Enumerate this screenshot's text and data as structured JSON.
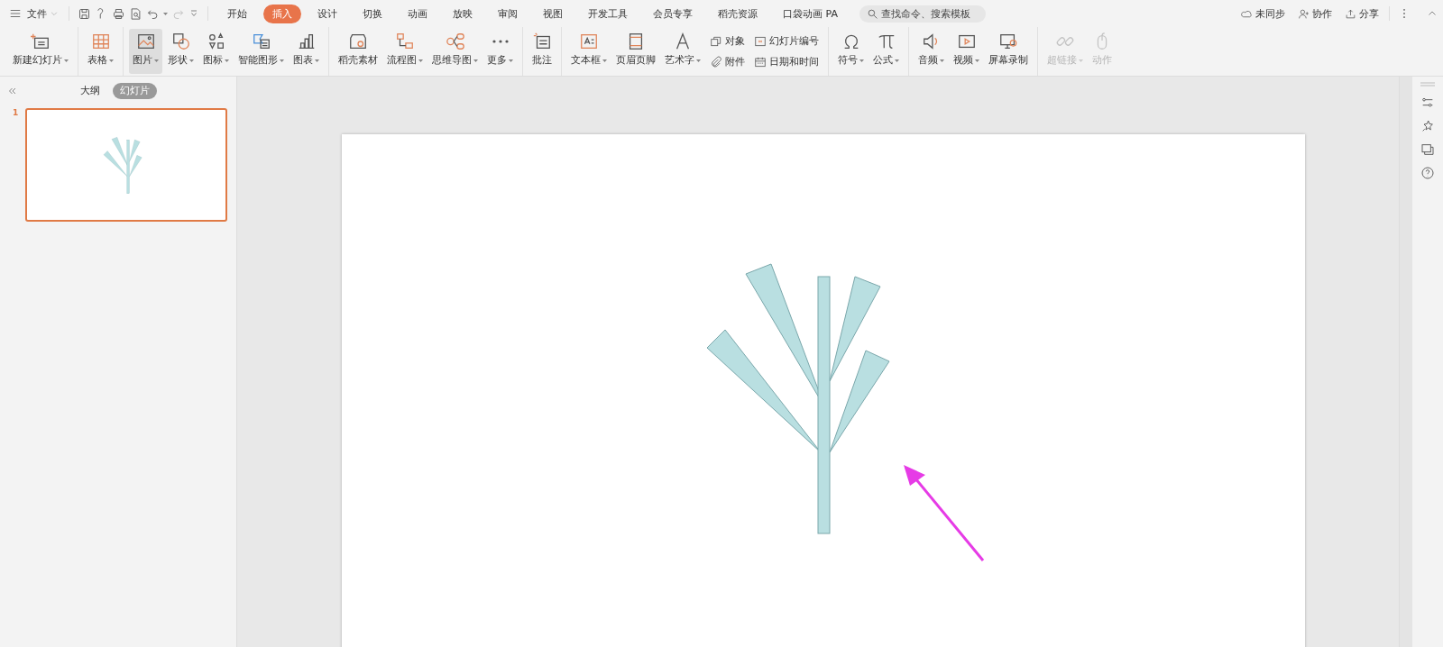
{
  "menu_bar": {
    "file_menu": "文件",
    "tabs": [
      {
        "label": "开始",
        "selected": false
      },
      {
        "label": "插入",
        "selected": true
      },
      {
        "label": "设计",
        "selected": false
      },
      {
        "label": "切换",
        "selected": false
      },
      {
        "label": "动画",
        "selected": false
      },
      {
        "label": "放映",
        "selected": false
      },
      {
        "label": "审阅",
        "selected": false
      },
      {
        "label": "视图",
        "selected": false
      },
      {
        "label": "开发工具",
        "selected": false
      },
      {
        "label": "会员专享",
        "selected": false
      },
      {
        "label": "稻壳资源",
        "selected": false
      },
      {
        "label": "口袋动画 PA",
        "selected": false
      }
    ],
    "search": {
      "placeholder": "查找命令、搜索模板"
    },
    "actions": [
      "未同步",
      "协作",
      "分享"
    ]
  },
  "ribbon": {
    "groups": [
      {
        "items": [
          {
            "kind": "large",
            "label": "新建幻灯片",
            "caret": true,
            "disabled": false,
            "pressed": false
          }
        ]
      },
      {
        "items": [
          {
            "kind": "large",
            "label": "表格",
            "caret": true,
            "disabled": false,
            "pressed": false
          }
        ]
      },
      {
        "items": [
          {
            "kind": "large",
            "label": "图片",
            "caret": true,
            "disabled": false,
            "pressed": true
          },
          {
            "kind": "large",
            "label": "形状",
            "caret": true,
            "disabled": false,
            "pressed": false
          },
          {
            "kind": "large",
            "label": "图标",
            "caret": true,
            "disabled": false,
            "pressed": false
          },
          {
            "kind": "large",
            "label": "智能图形",
            "caret": true,
            "disabled": false,
            "pressed": false
          },
          {
            "kind": "large",
            "label": "图表",
            "caret": true,
            "disabled": false,
            "pressed": false
          }
        ]
      },
      {
        "items": [
          {
            "kind": "large",
            "label": "稻壳素材",
            "caret": false,
            "disabled": false,
            "pressed": false
          },
          {
            "kind": "large",
            "label": "流程图",
            "caret": true,
            "disabled": false,
            "pressed": false
          },
          {
            "kind": "large",
            "label": "思维导图",
            "caret": true,
            "disabled": false,
            "pressed": false
          },
          {
            "kind": "large",
            "label": "更多",
            "caret": true,
            "disabled": false,
            "pressed": false
          }
        ]
      },
      {
        "items": [
          {
            "kind": "large",
            "label": "批注",
            "caret": false,
            "disabled": false,
            "pressed": false
          }
        ]
      },
      {
        "items": [
          {
            "kind": "large",
            "label": "文本框",
            "caret": true,
            "disabled": false,
            "pressed": false
          },
          {
            "kind": "large",
            "label": "页眉页脚",
            "caret": false,
            "disabled": false,
            "pressed": false
          },
          {
            "kind": "large",
            "label": "艺术字",
            "caret": true,
            "disabled": false,
            "pressed": false
          },
          {
            "kind": "small_column",
            "items": [
              {
                "label": "对象"
              },
              {
                "label": "附件"
              }
            ]
          },
          {
            "kind": "small_column",
            "items": [
              {
                "label": "幻灯片编号"
              },
              {
                "label": "日期和时间"
              }
            ]
          }
        ]
      },
      {
        "items": [
          {
            "kind": "large",
            "label": "符号",
            "caret": true,
            "disabled": false,
            "pressed": false
          },
          {
            "kind": "large",
            "label": "公式",
            "caret": true,
            "disabled": false,
            "pressed": false
          }
        ]
      },
      {
        "items": [
          {
            "kind": "large",
            "label": "音频",
            "caret": true,
            "disabled": false,
            "pressed": false
          },
          {
            "kind": "large",
            "label": "视频",
            "caret": true,
            "disabled": false,
            "pressed": false
          },
          {
            "kind": "large",
            "label": "屏幕录制",
            "caret": false,
            "disabled": false,
            "pressed": false
          }
        ]
      },
      {
        "items": [
          {
            "kind": "large",
            "label": "超链接",
            "caret": true,
            "disabled": true,
            "pressed": false
          },
          {
            "kind": "large",
            "label": "动作",
            "caret": false,
            "disabled": true,
            "pressed": false
          }
        ]
      }
    ]
  },
  "slide_panel": {
    "tabs": [
      {
        "label": "大纲",
        "selected": false
      },
      {
        "label": "幻灯片",
        "selected": true
      }
    ],
    "slides": [
      {
        "number": "1",
        "selected": true
      }
    ]
  }
}
